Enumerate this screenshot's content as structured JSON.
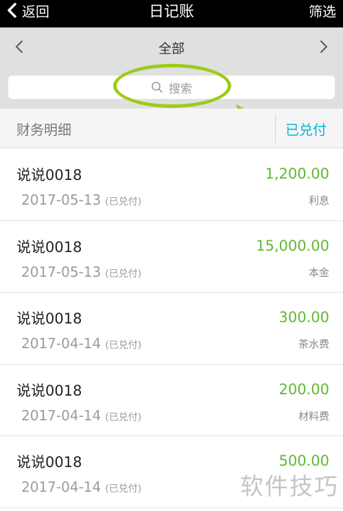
{
  "navbar": {
    "back_label": "返回",
    "title": "日记账",
    "filter_label": "筛选"
  },
  "period": {
    "label": "全部"
  },
  "search": {
    "placeholder": "搜索"
  },
  "tabs": {
    "detail": "财务明细",
    "paid": "已兑付"
  },
  "items": [
    {
      "title": "说说0018",
      "date": "2017-05-13",
      "status": "(已兑付)",
      "amount": "1,200.00",
      "category": "利息"
    },
    {
      "title": "说说0018",
      "date": "2017-05-13",
      "status": "(已兑付)",
      "amount": "15,000.00",
      "category": "本金"
    },
    {
      "title": "说说0018",
      "date": "2017-04-14",
      "status": "(已兑付)",
      "amount": "300.00",
      "category": "茶水费"
    },
    {
      "title": "说说0018",
      "date": "2017-04-14",
      "status": "(已兑付)",
      "amount": "200.00",
      "category": "材料费"
    },
    {
      "title": "说说0018",
      "date": "2017-04-14",
      "status": "(已兑付)",
      "amount": "500.00",
      "category": ""
    }
  ],
  "watermark": "软件技巧",
  "colors": {
    "accent_green": "#5fb832",
    "accent_blue": "#00b4d8",
    "annotation": "#9dcb17"
  }
}
